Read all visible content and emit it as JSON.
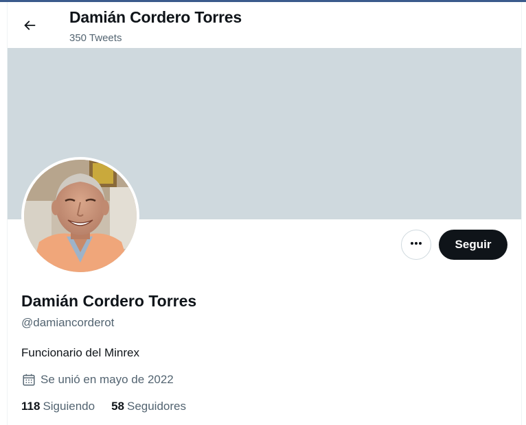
{
  "header": {
    "title": "Damián Cordero Torres",
    "tweet_count": "350 Tweets",
    "back_icon": "arrow-left-icon"
  },
  "colors": {
    "banner": "#cfd9de",
    "follow_bg": "#0f1419",
    "secondary_text": "#536471"
  },
  "actions": {
    "more_icon": "more-horizontal-icon",
    "follow_label": "Seguir"
  },
  "profile": {
    "display_name": "Damián Cordero Torres",
    "handle": "@damiancorderot",
    "bio": "Funcionario del Minrex",
    "joined_icon": "calendar-icon",
    "joined": "Se unió en mayo de 2022"
  },
  "stats": {
    "following_count": "118",
    "following_label": "Siguiendo",
    "followers_count": "58",
    "followers_label": "Seguidores"
  }
}
